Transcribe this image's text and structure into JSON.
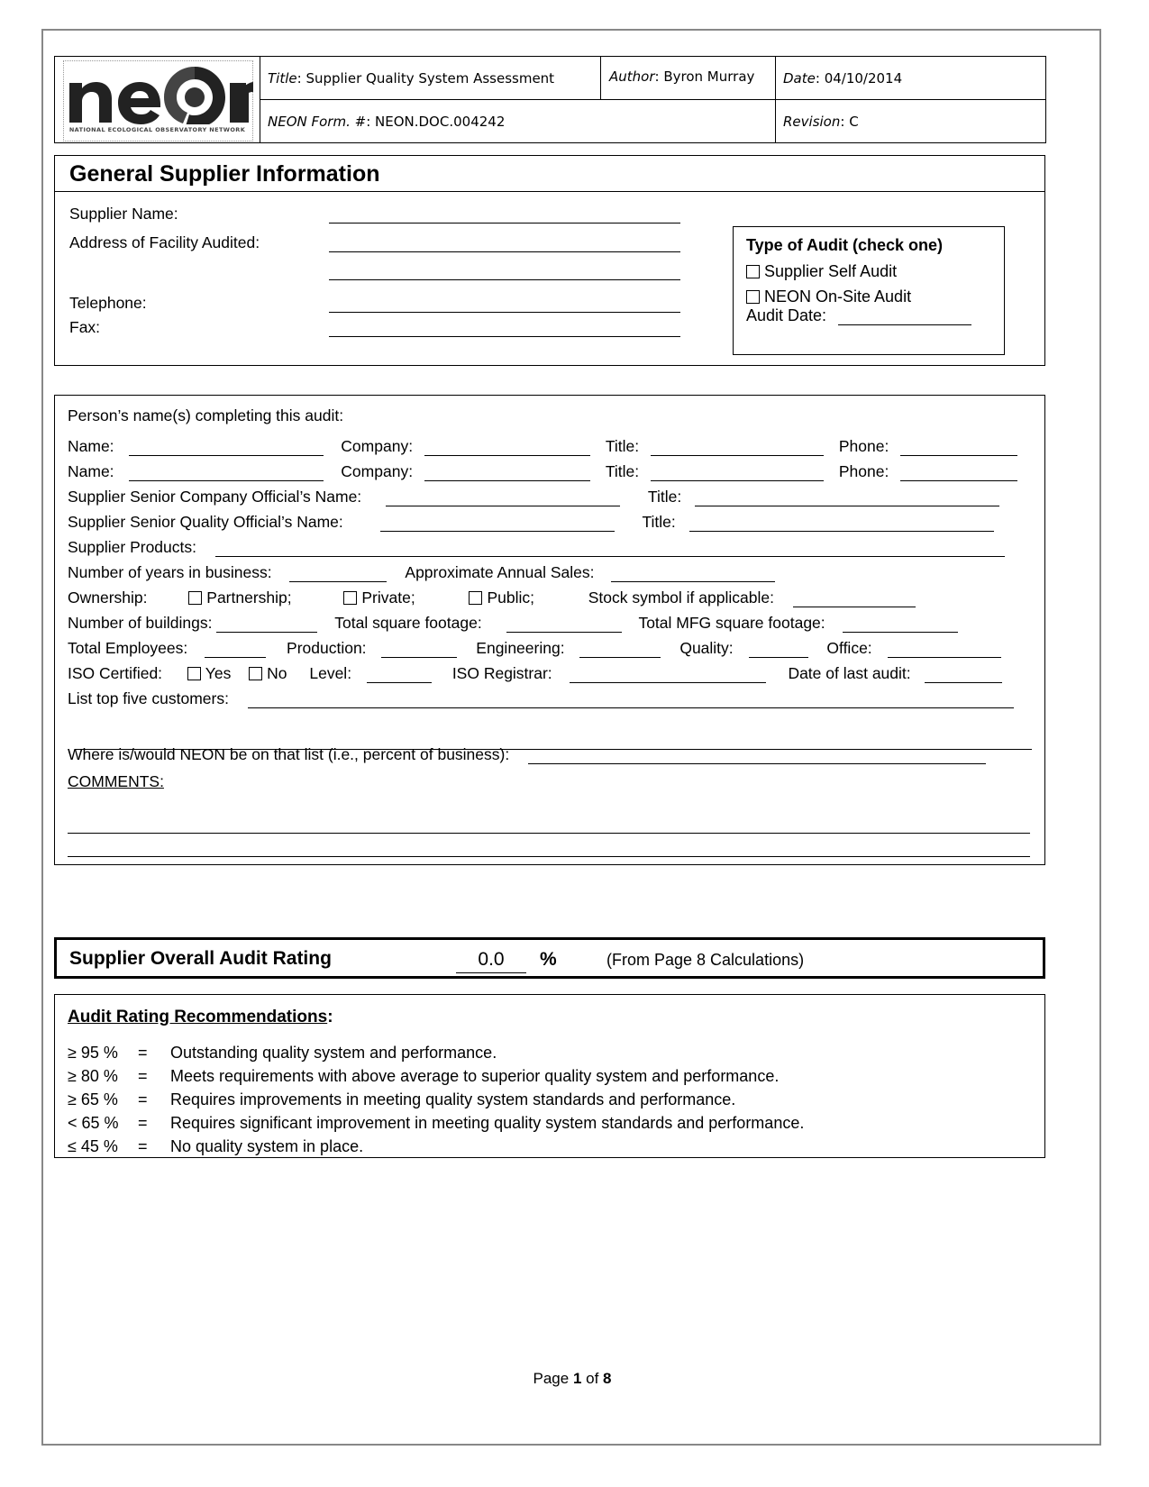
{
  "header": {
    "logo_tagline": "NATIONAL ECOLOGICAL OBSERVATORY NETWORK",
    "logo_name": "neon",
    "title_label": "Title",
    "title_value": "Supplier Quality System Assessment",
    "author_label": "Author",
    "author_value": "Byron Murray",
    "date_label": "Date",
    "date_value": "04/10/2014",
    "form_label": "NEON Form. #",
    "form_value": "NEON.DOC.004242",
    "revision_label": "Revision",
    "revision_value": "C"
  },
  "general": {
    "section_title": "General Supplier Information",
    "supplier_name": "Supplier Name:",
    "address": "Address of Facility Audited:",
    "telephone": "Telephone:",
    "fax": "Fax:",
    "type_of_audit": {
      "heading": "Type of Audit (check one)",
      "option_self": "Supplier Self Audit",
      "option_onsite": "NEON On-Site Audit",
      "audit_date": "Audit Date:"
    }
  },
  "audit_info": {
    "persons_completing": "Person’s name(s) completing this audit:",
    "name": "Name:",
    "company": "Company:",
    "title": "Title:",
    "phone": "Phone:",
    "senior_company_official": "Supplier Senior Company Official’s Name:",
    "senior_quality_official": "Supplier Senior Quality Official’s Name:",
    "supplier_products": "Supplier Products:",
    "years_in_business": "Number of years in business:",
    "annual_sales": "Approximate Annual Sales:",
    "ownership": "Ownership:",
    "partnership": "Partnership;",
    "private": "Private;",
    "public": "Public;",
    "stock_symbol": "Stock symbol if applicable:",
    "num_buildings": "Number of buildings:",
    "total_sq_ft": "Total square footage:",
    "total_mfg_sq_ft": "Total MFG square footage:",
    "total_employees": "Total Employees:",
    "production": "Production:",
    "engineering": "Engineering:",
    "quality": "Quality:",
    "office": "Office:",
    "iso_certified": "ISO Certified:",
    "yes": "Yes",
    "no": "No",
    "level": "Level:",
    "iso_registrar": "ISO Registrar:",
    "date_last_audit": "Date of last audit:",
    "top_five_customers": "List top five customers:",
    "neon_on_list": "Where is/would NEON be on that list (i.e., percent of business):",
    "comments": "COMMENTS:"
  },
  "rating": {
    "label": "Supplier Overall Audit Rating",
    "value": "0.0",
    "percent": "%",
    "source": "(From Page 8 Calculations)"
  },
  "recommendations": {
    "heading": "Audit Rating Recommendations",
    "heading_colon": ":",
    "items": [
      {
        "threshold": "≥ 95 %",
        "eq": "=",
        "text": "Outstanding quality system and performance."
      },
      {
        "threshold": "≥ 80 %",
        "eq": "=",
        "text": "Meets requirements with above average to superior quality system and performance."
      },
      {
        "threshold": "≥ 65 %",
        "eq": "=",
        "text": "Requires improvements in meeting quality system standards and performance."
      },
      {
        "threshold": "< 65 %",
        "eq": "=",
        "text": "Requires significant improvement in meeting quality system standards and performance."
      },
      {
        "threshold": "≤ 45 %",
        "eq": "=",
        "text": "No quality system in place."
      }
    ]
  },
  "footer": {
    "prefix": "Page ",
    "page": "1",
    "middle": " of ",
    "total": "8"
  }
}
